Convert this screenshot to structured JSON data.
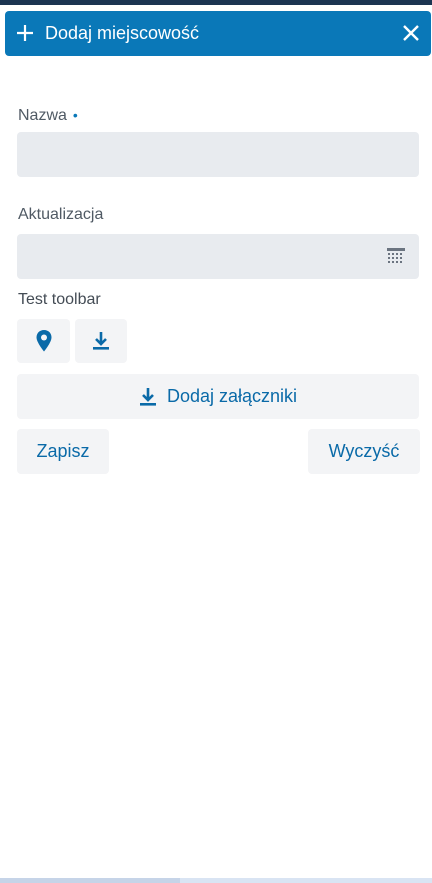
{
  "header": {
    "title": "Dodaj miejscowość",
    "plus_icon": "plus-icon",
    "close_icon": "close-icon",
    "bg_color": "#0a78b8"
  },
  "form": {
    "name_label": "Nazwa",
    "name_required_mark": "•",
    "name_value": "",
    "update_label": "Aktualizacja",
    "update_value": "",
    "calendar_icon": "calendar-icon",
    "toolbar_label": "Test toolbar",
    "toolbar_buttons": [
      {
        "icon": "map-marker-icon"
      },
      {
        "icon": "download-icon"
      }
    ],
    "attach_label": "Dodaj załączniki",
    "save_label": "Zapisz",
    "clear_label": "Wyczyść"
  },
  "colors": {
    "accent": "#0a78b8",
    "button_text": "#0a6aa8",
    "input_bg": "#e8ebef",
    "button_bg": "#f3f4f6"
  }
}
